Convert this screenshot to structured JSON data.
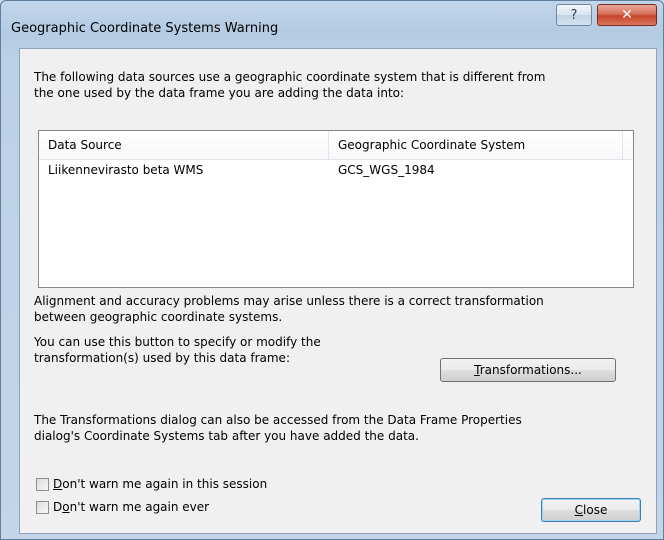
{
  "window": {
    "title": "Geographic Coordinate Systems Warning",
    "help_glyph": "?",
    "close_glyph": "✕"
  },
  "intro_text_line1": "The following data sources use a geographic coordinate system that is different from",
  "intro_text_line2": "the one used by the data frame you are adding the data into:",
  "table": {
    "columns": [
      "Data Source",
      "Geographic Coordinate System"
    ],
    "rows": [
      [
        "Liikennevirasto beta WMS",
        "GCS_WGS_1984"
      ]
    ]
  },
  "alignment_text_line1": "Alignment and accuracy problems may arise unless there is a correct transformation",
  "alignment_text_line2": "between geographic coordinate systems.",
  "transform_text_line1": "You can use this button to specify or modify the",
  "transform_text_line2": "transformation(s) used by this data frame:",
  "transformations_button": {
    "accel": "T",
    "rest": "ransformations..."
  },
  "dialog_text_line1": "The Transformations dialog can also be accessed from the Data Frame Properties",
  "dialog_text_line2": "dialog's Coordinate Systems tab after you have added the data.",
  "checkbox_session": {
    "accel": "D",
    "rest": "on't warn me again in this session",
    "checked": false
  },
  "checkbox_ever": {
    "pre": "D",
    "accel": "o",
    "rest": "n't warn me again ever",
    "checked": false
  },
  "close_button": {
    "accel": "C",
    "rest": "lose"
  }
}
